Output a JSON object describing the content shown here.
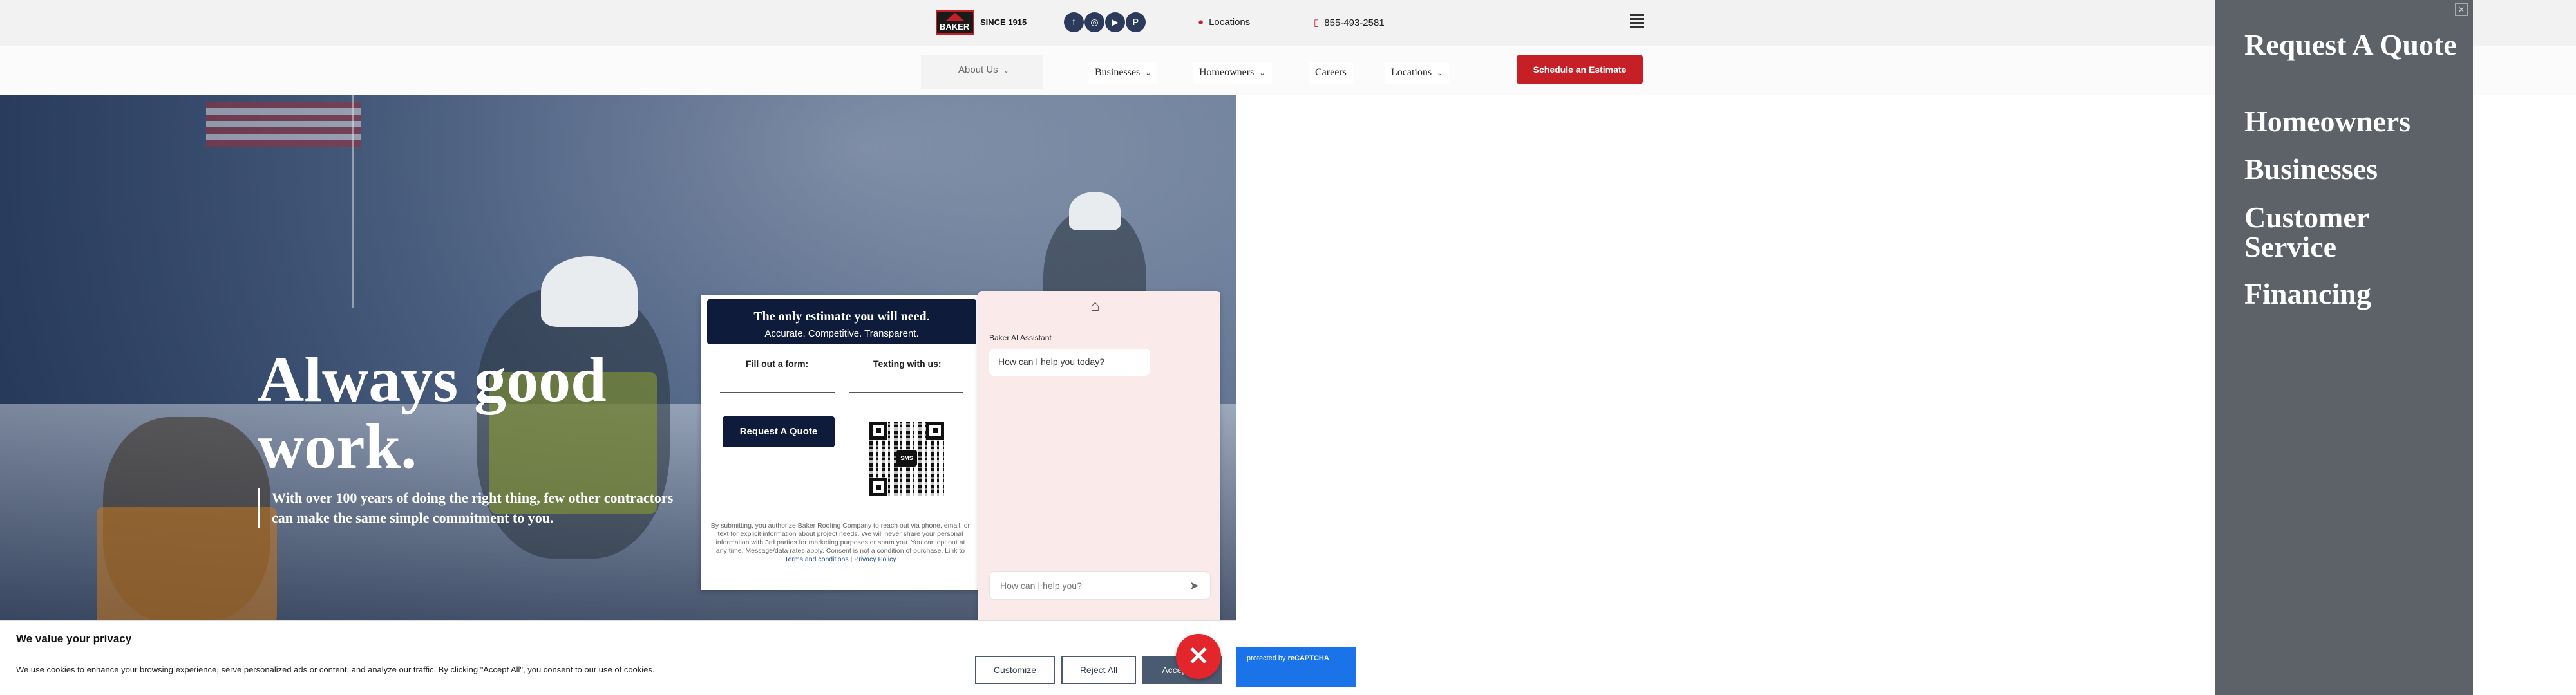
{
  "header": {
    "logo_text": "BAKER",
    "since": "SINCE 1915",
    "social": [
      "facebook-icon",
      "instagram-icon",
      "youtube-icon",
      "pinterest-icon"
    ],
    "locations_label": "Locations",
    "phone": "855-493-2581"
  },
  "nav": {
    "about": "About Us",
    "businesses": "Businesses",
    "homeowners": "Homeowners",
    "careers": "Careers",
    "locations": "Locations",
    "cta": "Schedule an Estimate"
  },
  "hero": {
    "title": "Always good work.",
    "subtitle": "With over 100 years of doing the right thing, few other contractors can make the same simple commitment to you."
  },
  "estimate_card": {
    "heading": "The only estimate you will need.",
    "subheading": "Accurate. Competitive. Transparent.",
    "form_label": "Fill out a form:",
    "text_label": "Texting with us:",
    "quote_button": "Request A Quote",
    "qr_badge": "SMS",
    "disclaimer": "By submitting, you authorize Baker Roofing Company to reach out via phone, email, or text for explicit information about project needs. We will never share your personal information with 3rd parties for marketing purposes or spam you. You can opt out at any time. Message/data rates apply. Consent is not a condition of purchase. Link to",
    "terms_link": "Terms and conditions",
    "separator": "|",
    "privacy_link": "Privacy Policy"
  },
  "chat": {
    "assistant_name": "Baker AI Assistant",
    "greeting": "How can I help you today?",
    "input_placeholder": "How can I help you?"
  },
  "cookie": {
    "title": "We value your privacy",
    "text": "We use cookies to enhance your browsing experience, serve personalized ads or content, and analyze our traffic. By clicking \"Accept All\", you consent to our use of cookies.",
    "customize": "Customize",
    "reject": "Reject All",
    "accept": "Accept All"
  },
  "recaptcha": {
    "prefix": "protected by",
    "brand": "reCAPTCHA"
  },
  "side_menu": {
    "items": [
      "Request A Quote",
      "Homeowners",
      "Businesses",
      "Customer Service",
      "Financing"
    ],
    "close": "✕"
  },
  "colors": {
    "brand_red": "#c62026",
    "navy": "#0e1b3a",
    "side_menu_bg": "#5d6168",
    "chat_bg": "#fbeaea"
  }
}
